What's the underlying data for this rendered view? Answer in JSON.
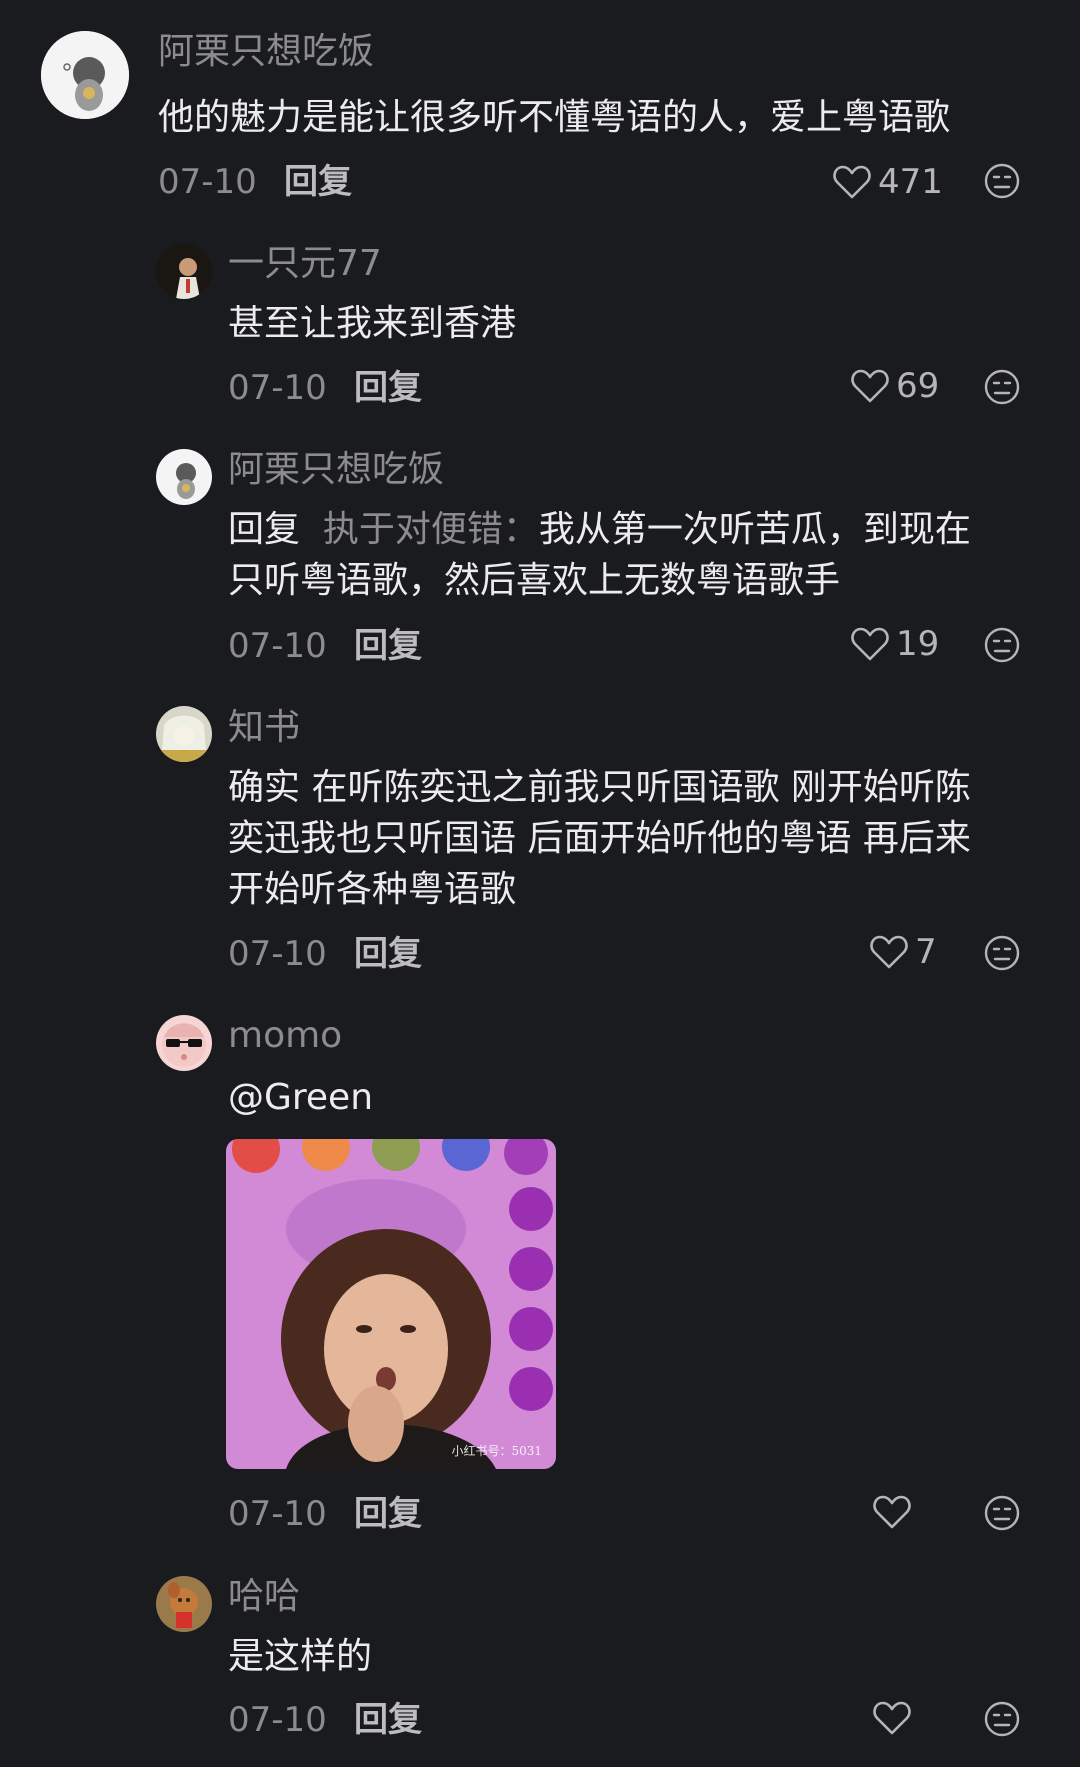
{
  "comments": [
    {
      "user": "阿栗只想吃饭",
      "lines": [
        "他的魅力是能让很多听不懂粤语的人，爱上粤语歌"
      ],
      "date": "07-10",
      "reply_label": "回复",
      "likes": "471"
    },
    {
      "user": "一只元77",
      "lines": [
        "甚至让我来到香港"
      ],
      "date": "07-10",
      "reply_label": "回复",
      "likes": "69"
    },
    {
      "user": "阿栗只想吃饭",
      "reply_prefix": "回复",
      "reply_target": "执于对便错：",
      "lines": [
        "我从第一次听苦瓜，到现在",
        "只听粤语歌，然后喜欢上无数粤语歌手"
      ],
      "date": "07-10",
      "reply_label": "回复",
      "likes": "19"
    },
    {
      "user": "知书",
      "lines": [
        "确实 在听陈奕迅之前我只听国语歌 刚开始听陈",
        "奕迅我也只听国语 后面开始听他的粤语 再后来",
        "开始听各种粤语歌"
      ],
      "date": "07-10",
      "reply_label": "回复",
      "likes": "7"
    },
    {
      "user": "momo",
      "lines": [
        "@Green"
      ],
      "date": "07-10",
      "reply_label": "回复",
      "likes": "",
      "image_watermark": "小红书号：5031"
    },
    {
      "user": "哈哈",
      "lines": [
        "是这样的"
      ],
      "date": "07-10",
      "reply_label": "回复",
      "likes": ""
    }
  ],
  "icons": {
    "like": "heart-outline-icon",
    "emoji": "emoji-face-icon"
  },
  "colors": {
    "background": "#1a1b1f",
    "text_primary": "#ececec",
    "text_secondary": "#8c8c8e"
  }
}
